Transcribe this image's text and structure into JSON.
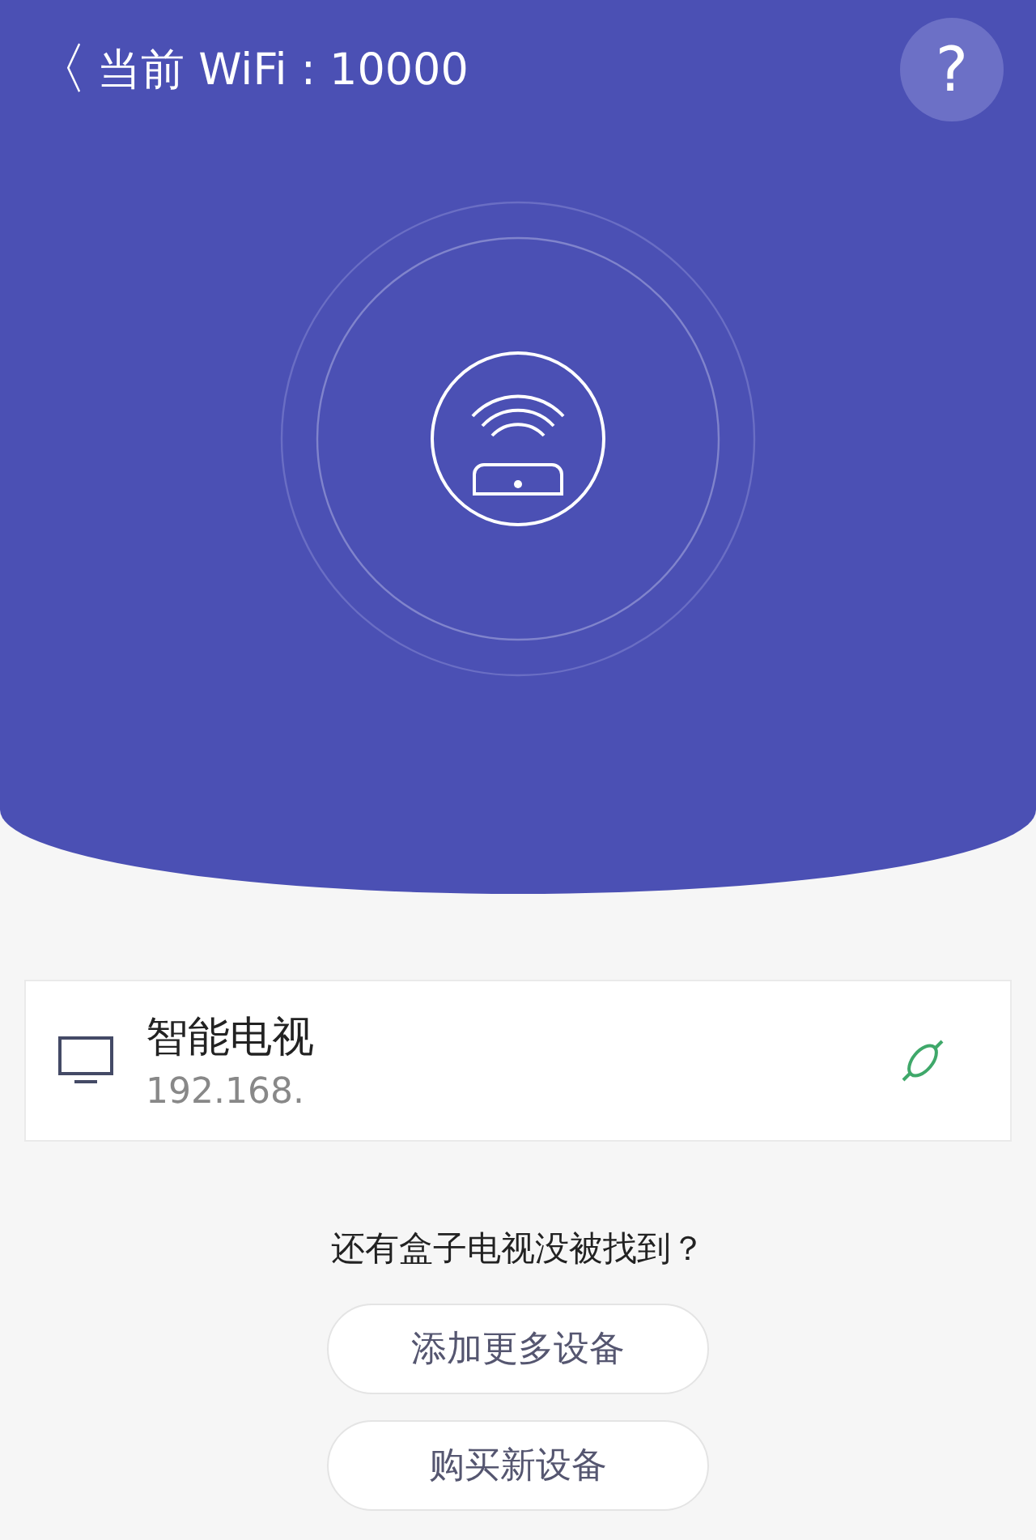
{
  "header": {
    "back": "〈",
    "title": "当前 WiFi : 10000",
    "help": "?"
  },
  "devices": [
    {
      "name": "智能电视",
      "ip": "192.168."
    }
  ],
  "prompt": "还有盒子电视没被找到？",
  "buttons": [
    "添加更多设备",
    "购买新设备"
  ]
}
